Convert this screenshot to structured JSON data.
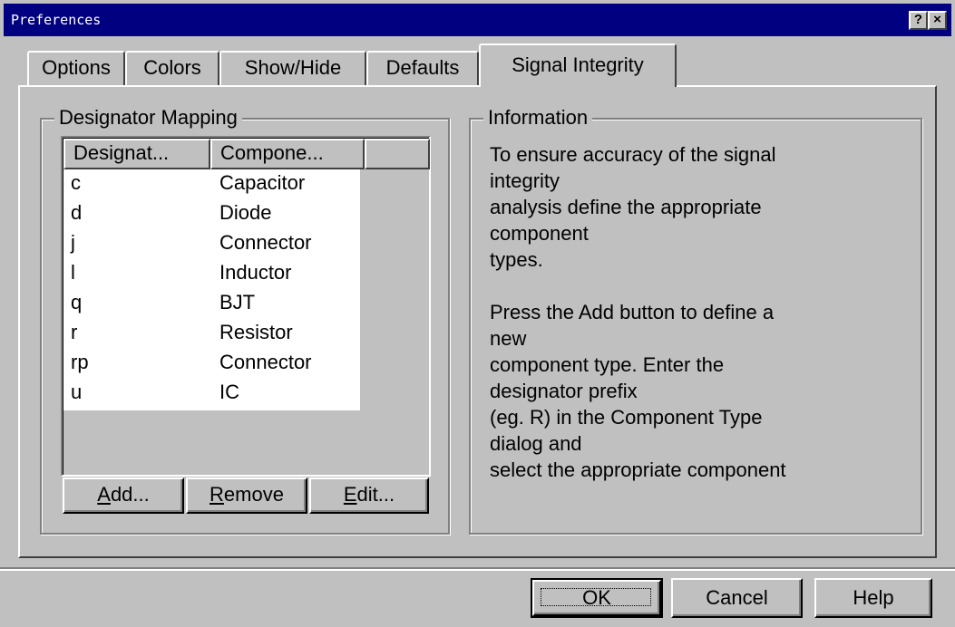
{
  "window": {
    "title": "Preferences",
    "help_button": "?",
    "close_button": "×"
  },
  "tabs": [
    {
      "label": "Options"
    },
    {
      "label": "Colors"
    },
    {
      "label": "Show/Hide"
    },
    {
      "label": "Defaults"
    },
    {
      "label": "Signal Integrity",
      "active": true
    }
  ],
  "designator_mapping": {
    "group_label": "Designator Mapping",
    "columns": [
      "Designat...",
      "Compone..."
    ],
    "rows": [
      {
        "designator": "c",
        "component": "Capacitor"
      },
      {
        "designator": "d",
        "component": "Diode"
      },
      {
        "designator": "j",
        "component": "Connector"
      },
      {
        "designator": "l",
        "component": "Inductor"
      },
      {
        "designator": "q",
        "component": "BJT"
      },
      {
        "designator": "r",
        "component": "Resistor"
      },
      {
        "designator": "rp",
        "component": "Connector"
      },
      {
        "designator": "u",
        "component": "IC"
      }
    ],
    "buttons": {
      "add": {
        "accel": "A",
        "rest": "dd..."
      },
      "remove": {
        "accel": "R",
        "rest": "emove"
      },
      "edit": {
        "accel": "E",
        "rest": "dit..."
      }
    }
  },
  "information": {
    "group_label": "Information",
    "lines": [
      "To ensure accuracy of the signal",
      "integrity",
      "analysis define the appropriate",
      "component",
      "types.",
      "",
      "Press the Add button to define a",
      "new",
      "component type. Enter the",
      "designator prefix",
      "(eg. R) in the Component Type",
      "dialog and",
      "select the appropriate component"
    ]
  },
  "footer": {
    "ok": "OK",
    "cancel": "Cancel",
    "help": "Help"
  },
  "colors": {
    "face": "#c0c0c0",
    "titlebar": "#000080",
    "list_background": "#ffffff"
  }
}
